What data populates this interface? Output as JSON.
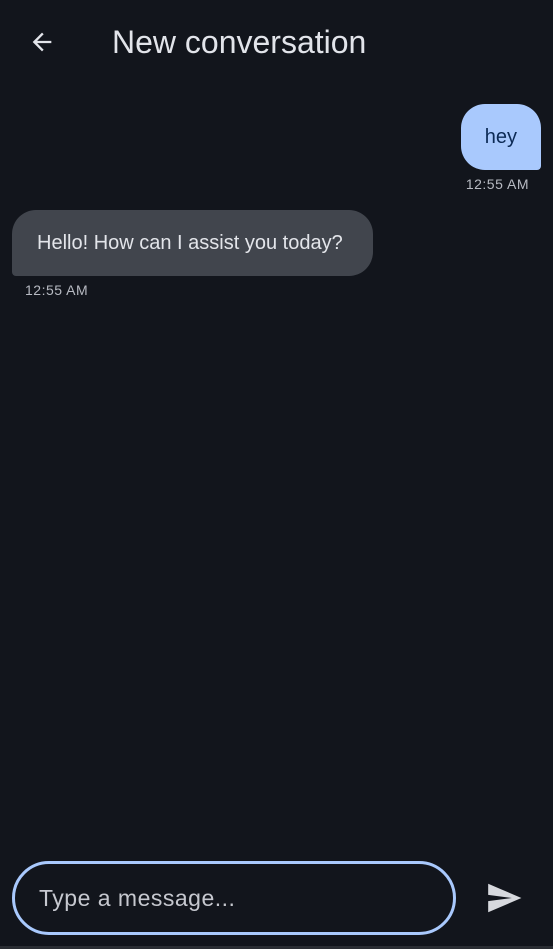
{
  "header": {
    "back_icon": "arrow-left-icon",
    "title": "New conversation"
  },
  "messages": [
    {
      "sender": "user",
      "text": "hey",
      "time": "12:55 AM"
    },
    {
      "sender": "assistant",
      "text": "Hello! How can I assist you today?",
      "time": "12:55 AM"
    }
  ],
  "composer": {
    "placeholder": "Type a message...",
    "value": "",
    "send_icon": "send-icon"
  },
  "colors": {
    "background": "#12151c",
    "user_bubble": "#a9c9fd",
    "assistant_bubble": "#41454d",
    "accent": "#a9c9fd"
  }
}
